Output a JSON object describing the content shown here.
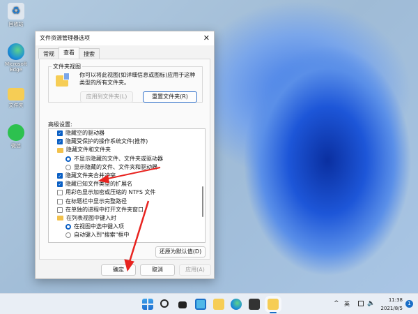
{
  "desktop": {
    "icons": [
      {
        "label": "回收站"
      },
      {
        "label": "Microsoft Edge"
      },
      {
        "label": "文件夹"
      },
      {
        "label": "微信"
      }
    ]
  },
  "dialog": {
    "title": "文件资源管理器选项",
    "close": "✕",
    "tabs": [
      "常规",
      "查看",
      "搜索"
    ],
    "active_tab": "查看",
    "folder_view": {
      "legend": "文件夹视图",
      "description": "你可以将此视图(如详细信息或图标)应用于这种类型的所有文件夹。",
      "apply_label": "应用到文件夹(L)",
      "reset_label": "重置文件夹(R)"
    },
    "advanced_label": "高级设置:",
    "settings": [
      {
        "type": "checkbox",
        "checked": true,
        "label": "隐藏空的驱动器",
        "indent": 1
      },
      {
        "type": "checkbox",
        "checked": true,
        "label": "隐藏受保护的操作系统文件(推荐)",
        "indent": 1
      },
      {
        "type": "folder",
        "label": "隐藏文件和文件夹",
        "indent": 1
      },
      {
        "type": "radio",
        "checked": true,
        "label": "不显示隐藏的文件、文件夹或驱动器",
        "indent": 2
      },
      {
        "type": "radio",
        "checked": false,
        "label": "显示隐藏的文件、文件夹和驱动器",
        "indent": 2
      },
      {
        "type": "checkbox",
        "checked": true,
        "label": "隐藏文件夹合并冲突",
        "indent": 1
      },
      {
        "type": "checkbox",
        "checked": true,
        "label": "隐藏已知文件类型的扩展名",
        "indent": 1
      },
      {
        "type": "checkbox",
        "checked": false,
        "label": "用彩色显示加密或压缩的 NTFS 文件",
        "indent": 1
      },
      {
        "type": "checkbox",
        "checked": false,
        "label": "在标题栏中显示完整路径",
        "indent": 1
      },
      {
        "type": "checkbox",
        "checked": false,
        "label": "在单独的进程中打开文件夹窗口",
        "indent": 1
      },
      {
        "type": "folder",
        "label": "在列表视图中键入时",
        "indent": 1
      },
      {
        "type": "radio",
        "checked": true,
        "label": "在视图中选中键入项",
        "indent": 2
      },
      {
        "type": "radio",
        "checked": false,
        "label": "自动键入到\"搜索\"框中",
        "indent": 2
      }
    ],
    "restore_label": "还原为默认值(D)",
    "ok_label": "确定",
    "cancel_label": "取消",
    "apply_label": "应用(A)"
  },
  "taskbar": {
    "ime": "英",
    "time": "11:38",
    "date": "2021/8/5",
    "notification_count": "1",
    "chevron": "^"
  },
  "colors": {
    "accent": "#0a5fc4",
    "arrow": "#e8231f"
  }
}
